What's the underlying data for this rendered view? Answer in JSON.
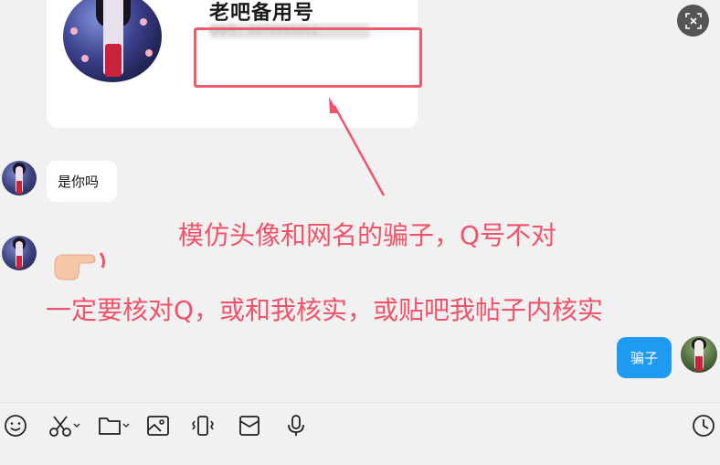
{
  "profile_card": {
    "name": "老吧备用号",
    "qq_number_blurred": "QQ号：2872655012"
  },
  "messages": [
    {
      "side": "left",
      "text": "是你吗"
    },
    {
      "side": "left",
      "text": "",
      "kind": "pointing-hand-emoji"
    },
    {
      "side": "right",
      "text": "骗子"
    }
  ],
  "annotations": {
    "line1": "模仿头像和网名的骗子，Q号不对",
    "line2": "一定要核对Q，或和我核实，或贴吧我帖子内核实"
  },
  "colors": {
    "annotation_red": "#f0536a",
    "self_bubble": "#1e9bf0",
    "chat_bg": "#f1f1f1"
  },
  "toolbar": {
    "icons": [
      "emoji-icon",
      "scissors-icon",
      "folder-icon",
      "image-icon",
      "vibrate-icon",
      "red-packet-icon",
      "microphone-icon",
      "history-clock-icon"
    ]
  }
}
